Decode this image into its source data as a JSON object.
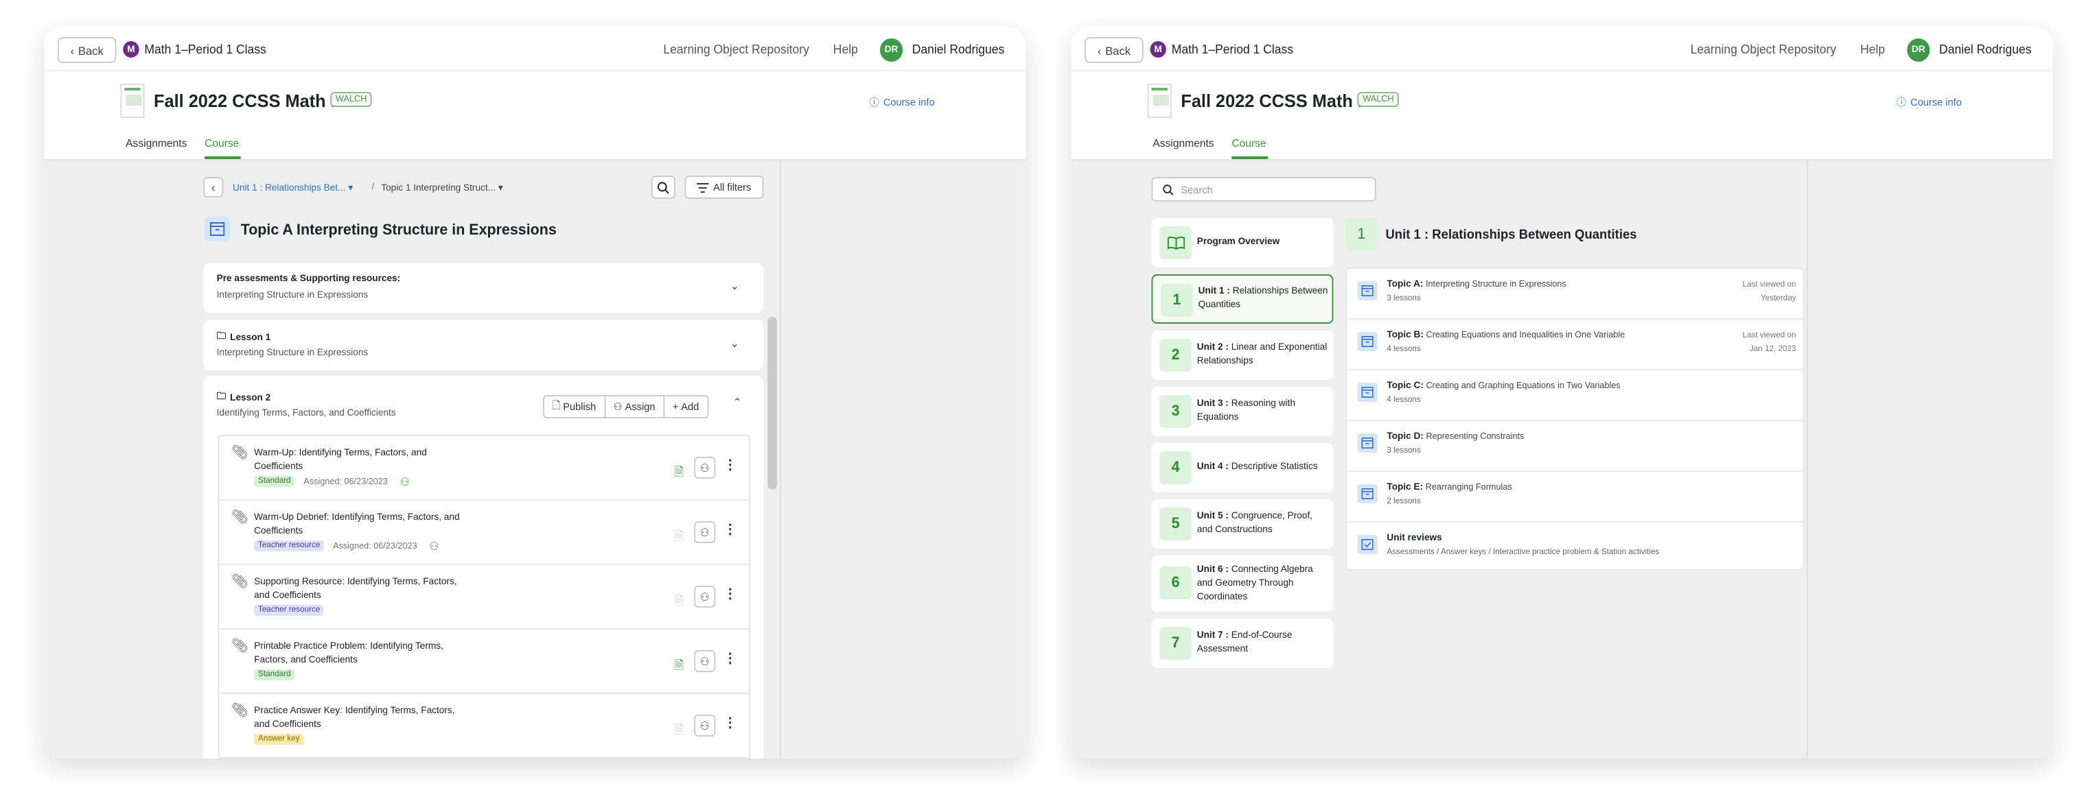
{
  "windows": [
    {
      "topbar": {
        "back": "Back",
        "class_initial": "M",
        "class_name": "Math 1–Period 1 Class",
        "nav": [
          "Learning Object Repository",
          "Help"
        ],
        "avatar_initials": "DR",
        "user": "Daniel Rodrigues"
      },
      "header": {
        "course_title": "Fall 2022 CCSS Math I",
        "publisher": "WALCH",
        "course_info": "Course info",
        "tabs": [
          "Assignments",
          "Course"
        ],
        "active_tab": "Course"
      },
      "toolbar": {
        "crumb_unit": "Unit 1 : Relationships Bet...",
        "crumb_topic": "Topic 1 Interpreting Struct...",
        "filters": "All filters"
      },
      "topic_title": "Topic A Interpreting Structure in Expressions",
      "sections": [
        {
          "title": "Pre assesments & Supporting resources:",
          "subtitle": "Interpreting Structure in Expressions"
        },
        {
          "title": "Lesson 1",
          "subtitle": "Interpreting Structure in Expressions"
        }
      ],
      "lesson2": {
        "title": "Lesson 2",
        "subtitle": "Identifying Terms, Factors, and Coefficients",
        "actions": [
          "Publish",
          "Assign",
          "Add"
        ],
        "items": [
          {
            "title": "Warm-Up: Identifying Terms, Factors, and Coefficients",
            "tag": "Standard",
            "assigned": "Assigned: 06/23/2023"
          },
          {
            "title": "Warm-Up Debrief: Identifying Terms, Factors, and Coefficients",
            "tag": "Teacher resource",
            "assigned": "Assigned: 06/23/2023"
          },
          {
            "title": "Supporting Resource: Identifying Terms, Factors, and Coefficients",
            "tag": "Teacher resource",
            "assigned": ""
          },
          {
            "title": "Printable Practice Problem: Identifying Terms, Factors, and Coefficients",
            "tag": "Standard",
            "assigned": ""
          },
          {
            "title": "Practice Answer Key: Identifying Terms, Factors, and Coefficients",
            "tag": "Answer key",
            "assigned": ""
          }
        ]
      }
    },
    {
      "topbar": {
        "back": "Back",
        "class_initial": "M",
        "class_name": "Math 1–Period 1 Class",
        "nav": [
          "Learning Object Repository",
          "Help"
        ],
        "avatar_initials": "DR",
        "user": "Daniel Rodrigues"
      },
      "header": {
        "course_title": "Fall 2022 CCSS Math I",
        "publisher": "WALCH",
        "course_info": "Course info",
        "tabs": [
          "Assignments",
          "Course"
        ],
        "active_tab": "Course"
      },
      "search_placeholder": "Search",
      "program_overview": "Program Overview",
      "units": [
        {
          "num": "1",
          "label": "Unit 1 :",
          "name": "Relationships Between Quantities"
        },
        {
          "num": "2",
          "label": "Unit 2 :",
          "name": "Linear and Exponential Relationships"
        },
        {
          "num": "3",
          "label": "Unit 3 :",
          "name": "Reasoning with Equations"
        },
        {
          "num": "4",
          "label": "Unit 4 :",
          "name": "Descriptive Statistics"
        },
        {
          "num": "5",
          "label": "Unit 5 :",
          "name": "Congruence, Proof, and Constructions"
        },
        {
          "num": "6",
          "label": "Unit 6 :",
          "name": "Connecting Algebra and Geometry Through Coordinates"
        },
        {
          "num": "7",
          "label": "Unit 7 :",
          "name": "End-of-Course Assessment"
        }
      ],
      "selected_unit": {
        "num": "1",
        "title": "Unit 1 : Relationships Between Quantities"
      },
      "topics": [
        {
          "label": "Topic A:",
          "name": "Interpreting Structure in Expressions",
          "lessons": "3 lessons",
          "last_viewed_label": "Last viewed on",
          "last_viewed": "Yesterday"
        },
        {
          "label": "Topic B:",
          "name": "Creating Equations and Inequalities in One Variable",
          "lessons": "4 lessons",
          "last_viewed_label": "Last viewed on",
          "last_viewed": "Jan 12, 2023"
        },
        {
          "label": "Topic C:",
          "name": "Creating and Graphing Equations in Two Variables",
          "lessons": "4 lessons"
        },
        {
          "label": "Topic D:",
          "name": "Representing Constraints",
          "lessons": "3 lessons"
        },
        {
          "label": "Topic E:",
          "name": "Rearranging Formulas",
          "lessons": "2 lessons"
        },
        {
          "label": "Unit reviews",
          "name": "",
          "lessons": "Assessments / Answer keys / Interactive practice problem & Station activities"
        }
      ]
    }
  ],
  "colors": {
    "accent_green": "#3a9a3a",
    "link_blue": "#2f6fd1",
    "class_purple": "#6b2d8a"
  }
}
